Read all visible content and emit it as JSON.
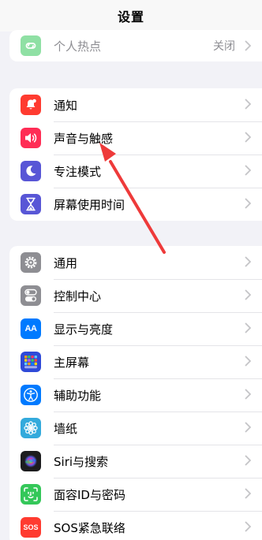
{
  "nav": {
    "title": "设置"
  },
  "hotspot": {
    "label": "个人热点",
    "value": "关闭",
    "icon": "hotspot-chain-icon"
  },
  "group1": [
    {
      "label": "通知",
      "icon": "bell-icon",
      "color": "#ff3b30"
    },
    {
      "label": "声音与触感",
      "icon": "speaker-icon",
      "color": "#ff2d55"
    },
    {
      "label": "专注模式",
      "icon": "moon-icon",
      "color": "#5856d6"
    },
    {
      "label": "屏幕使用时间",
      "icon": "hourglass-icon",
      "color": "#5856d6"
    }
  ],
  "group2": [
    {
      "label": "通用",
      "icon": "gear-icon",
      "color": "#8e8e93"
    },
    {
      "label": "控制中心",
      "icon": "toggles-icon",
      "color": "#8e8e93"
    },
    {
      "label": "显示与亮度",
      "icon": "aa-text-icon",
      "color": "#007aff"
    },
    {
      "label": "主屏幕",
      "icon": "app-grid-icon",
      "color": "#2f4ad8"
    },
    {
      "label": "辅助功能",
      "icon": "accessibility-icon",
      "color": "#007aff"
    },
    {
      "label": "墙纸",
      "icon": "flower-icon",
      "color": "#34aadc"
    },
    {
      "label": "Siri与搜索",
      "icon": "siri-icon",
      "color": "#1c1c1e"
    },
    {
      "label": "面容ID与密码",
      "icon": "face-id-icon",
      "color": "#34c759"
    },
    {
      "label": "SOS紧急联络",
      "icon": "sos-icon",
      "color": "#ff3b30"
    }
  ],
  "icon_glyph_text": {
    "display": "AA",
    "sos": "SOS"
  },
  "annotation": {
    "arrow_color": "#ee3a3a",
    "points_to": "声音与触感"
  }
}
